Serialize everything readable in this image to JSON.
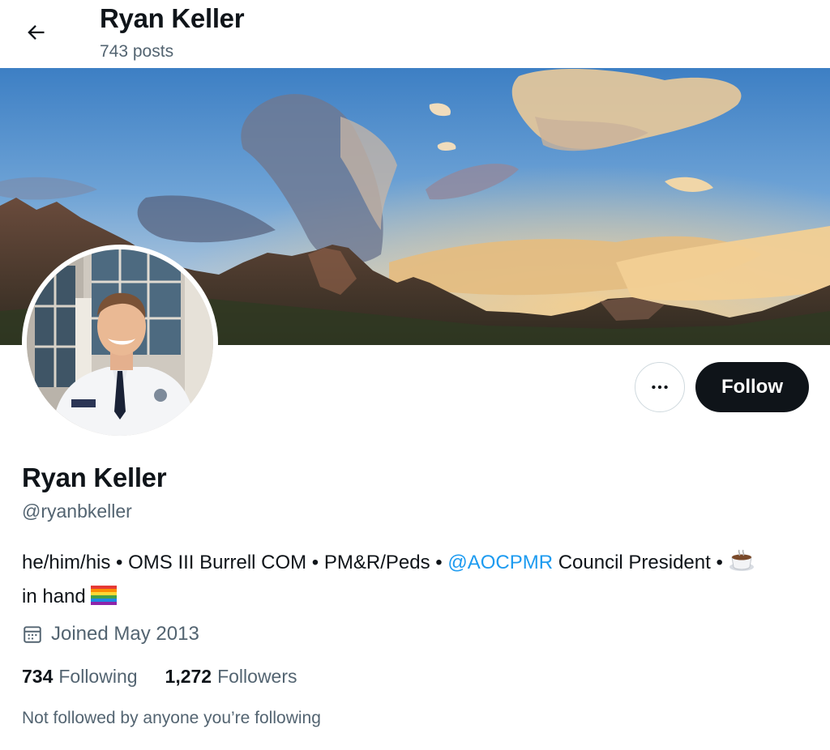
{
  "header": {
    "name": "Ryan Keller",
    "posts": "743 posts"
  },
  "profile": {
    "display_name": "Ryan Keller",
    "handle": "@ryanbkeller",
    "bio": {
      "part1": "he/him/his • OMS III Burrell COM • PM&R/Peds • ",
      "mention": "@AOCPMR",
      "part2": " Council President • ",
      "emoji1_name": "hot-beverage-emoji",
      "part3": " in hand ",
      "emoji2_name": "rainbow-flag-emoji"
    },
    "joined": "Joined May 2013",
    "following_count": "734",
    "following_label": "Following",
    "followers_count": "1,272",
    "followers_label": "Followers",
    "not_followed": "Not followed by anyone you’re following"
  },
  "actions": {
    "more_icon": "more-horizontal-icon",
    "follow_label": "Follow"
  },
  "colors": {
    "text_primary": "#0f1419",
    "text_secondary": "#536471",
    "link": "#1d9bf0",
    "follow_bg": "#0f1419",
    "border": "#cfd9de"
  }
}
